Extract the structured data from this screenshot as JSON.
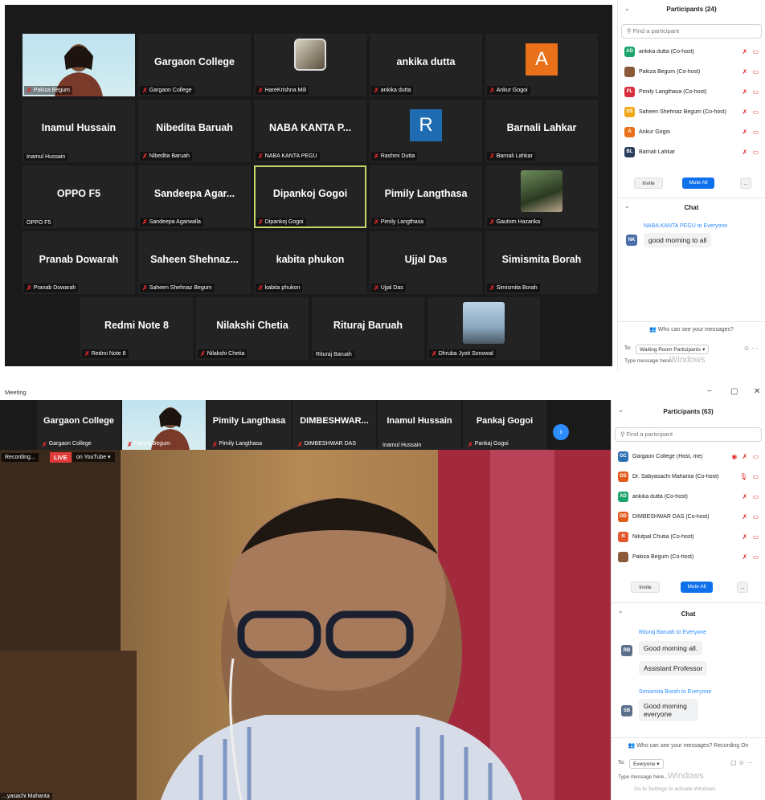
{
  "win1": {
    "tiles": [
      {
        "name": "",
        "label": "Pakiza Begum",
        "type": "photo"
      },
      {
        "name": "Gargaon College",
        "label": "Gargaon College"
      },
      {
        "name": "",
        "label": "HareKrishna Mili",
        "type": "pic"
      },
      {
        "name": "ankika dutta",
        "label": "ankika dutta"
      },
      {
        "name": "",
        "label": "Ankur Gogoi",
        "avatar": "A",
        "avatar_color": "#e8711a"
      },
      {
        "name": "Inamul Hussain",
        "label": "Inamul Hussain",
        "nomic": true
      },
      {
        "name": "Nibedita Baruah",
        "label": "Nibedita Baruah"
      },
      {
        "name": "NABA KANTA P...",
        "label": "NABA KANTA PEGU"
      },
      {
        "name": "",
        "label": "Rashmi Dutta",
        "avatar": "R",
        "avatar_color": "#1f6cb3"
      },
      {
        "name": "Barnali Lahkar",
        "label": "Barnali Lahkar"
      },
      {
        "name": "OPPO F5",
        "label": "OPPO F5",
        "nomic": true
      },
      {
        "name": "Sandeepa Agar...",
        "label": "Sandeepa Agarwalla"
      },
      {
        "name": "Dipankoj Gogoi",
        "label": "Dipankoj Gogoi",
        "highlight": true
      },
      {
        "name": "Pimily Langthasa",
        "label": "Pimily Langthasa"
      },
      {
        "name": "",
        "label": "Gautom Hazarika",
        "type": "pic2"
      },
      {
        "name": "Pranab Dowarah",
        "label": "Pranab Dowarah"
      },
      {
        "name": "Saheen Shehnaz...",
        "label": "Saheen Shehnaz Begum"
      },
      {
        "name": "kabita phukon",
        "label": "kabita phukon"
      },
      {
        "name": "Ujjal Das",
        "label": "Ujjal Das"
      },
      {
        "name": "Simismita Borah",
        "label": "Simismita Borah"
      },
      {
        "name": "Redmi Note 8",
        "label": "Redmi Note 8"
      },
      {
        "name": "Nilakshi Chetia",
        "label": "Nilakshi Chetia"
      },
      {
        "name": "Rituraj Baruah",
        "label": "Rituraj Baruah",
        "nomic": true
      },
      {
        "name": "",
        "label": "Dhruba Jyoti Sonowal",
        "type": "pic3"
      }
    ],
    "panel": {
      "title": "Participants (24)",
      "search_placeholder": "Find a participant",
      "participants": [
        {
          "initials": "AD",
          "color": "#1aa36a",
          "name": "ankika dutta (Co-host)",
          "icons": "✗ ▭"
        },
        {
          "initials": "",
          "color": "#8a5a3a",
          "name": "Pakiza Begum (Co-host)",
          "icons": "✗ ▭"
        },
        {
          "initials": "PL",
          "color": "#d62e3c",
          "name": "Pimily Langthasa (Co-host)",
          "icons": "✗ ▭"
        },
        {
          "initials": "SS",
          "color": "#f0a818",
          "name": "Saheen Shehnaz Begum (Co-host)",
          "icons": "✗ ▭"
        },
        {
          "initials": "A",
          "color": "#e8711a",
          "name": "Ankur Gogoi",
          "icons": "✗ ▭"
        },
        {
          "initials": "BL",
          "color": "#2b3d5c",
          "name": "Barnali Lahkar",
          "icons": "✗ ▭"
        }
      ],
      "invite": "Invite",
      "mute_all": "Mute All",
      "more": "...",
      "chat_title": "Chat",
      "chat_from": "NABA KANTA PEGU to Everyone",
      "chat_initials": "NK",
      "chat_msg": "good morning to all",
      "who_can_see": "Who can see your messages?",
      "to_label": "To:",
      "to_value": "Waiting Room Participants ▾",
      "type_msg": "Type message here...",
      "watermark": "Windows"
    }
  },
  "win2": {
    "title": "Meeting",
    "controls": [
      "−",
      "▢",
      "✕"
    ],
    "strip": [
      {
        "name": "Gargaon College",
        "label": "Gargaon College"
      },
      {
        "name": "",
        "label": "Pakiza Begum",
        "type": "photo"
      },
      {
        "name": "Pimily Langthasa",
        "label": "Pimily Langthasa"
      },
      {
        "name": "DIMBESHWAR...",
        "label": "DIMBESHWAR DAS"
      },
      {
        "name": "Inamul Hussain",
        "label": "Inamul Hussain",
        "nomic": true
      },
      {
        "name": "Pankaj Gogoi",
        "label": "Pankaj Gogoi"
      }
    ],
    "next_icon": "›",
    "recording": "Recording...",
    "live": "LIVE",
    "on_youtube": "on YouTube ▾",
    "speaker_label": "...yasachi Mahanta",
    "panel": {
      "title": "Participants (63)",
      "search_placeholder": "Find a participant",
      "participants": [
        {
          "initials": "GC",
          "color": "#2d6fb5",
          "name": "Gargaon College (Host, me)",
          "icons": "◉ ✗ ▭"
        },
        {
          "initials": "DS",
          "color": "#e25a1c",
          "name": "Dr. Sabyasachi Mahanta (Co-host)",
          "icons": "🎙 ▭"
        },
        {
          "initials": "AD",
          "color": "#1aa36a",
          "name": "ankika dutta (Co-host)",
          "icons": "✗ ▭"
        },
        {
          "initials": "DD",
          "color": "#e25a1c",
          "name": "DIMBESHWAR DAS (Co-host)",
          "icons": "✗ ▭"
        },
        {
          "initials": "N",
          "color": "#e2552d",
          "name": "Nilutpal Chutia (Co-host)",
          "icons": "✗ ▭"
        },
        {
          "initials": "",
          "color": "#8a5a3a",
          "name": "Pakiza Begum (Co-host)",
          "icons": "✗ ▭"
        }
      ],
      "invite": "Invite",
      "mute_all": "Mute All",
      "more": "...",
      "chat_title": "Chat",
      "chat1_from": "Rituraj Baruah to Everyone",
      "chat1_initials": "RB",
      "chat1_msg1": "Good morning all.",
      "chat1_msg2": "Assistant  Professor",
      "chat2_from": "Simismita Borah to Everyone",
      "chat2_initials": "SB",
      "chat2_msg": "Good morning everyone",
      "who_can_see": "Who can see your messages? Recording On",
      "to_label": "To:",
      "to_value": "Everyone ▾",
      "type_msg": "Type message here...",
      "watermark": "Windows",
      "activate": "Go to Settings to activate Windows."
    }
  }
}
